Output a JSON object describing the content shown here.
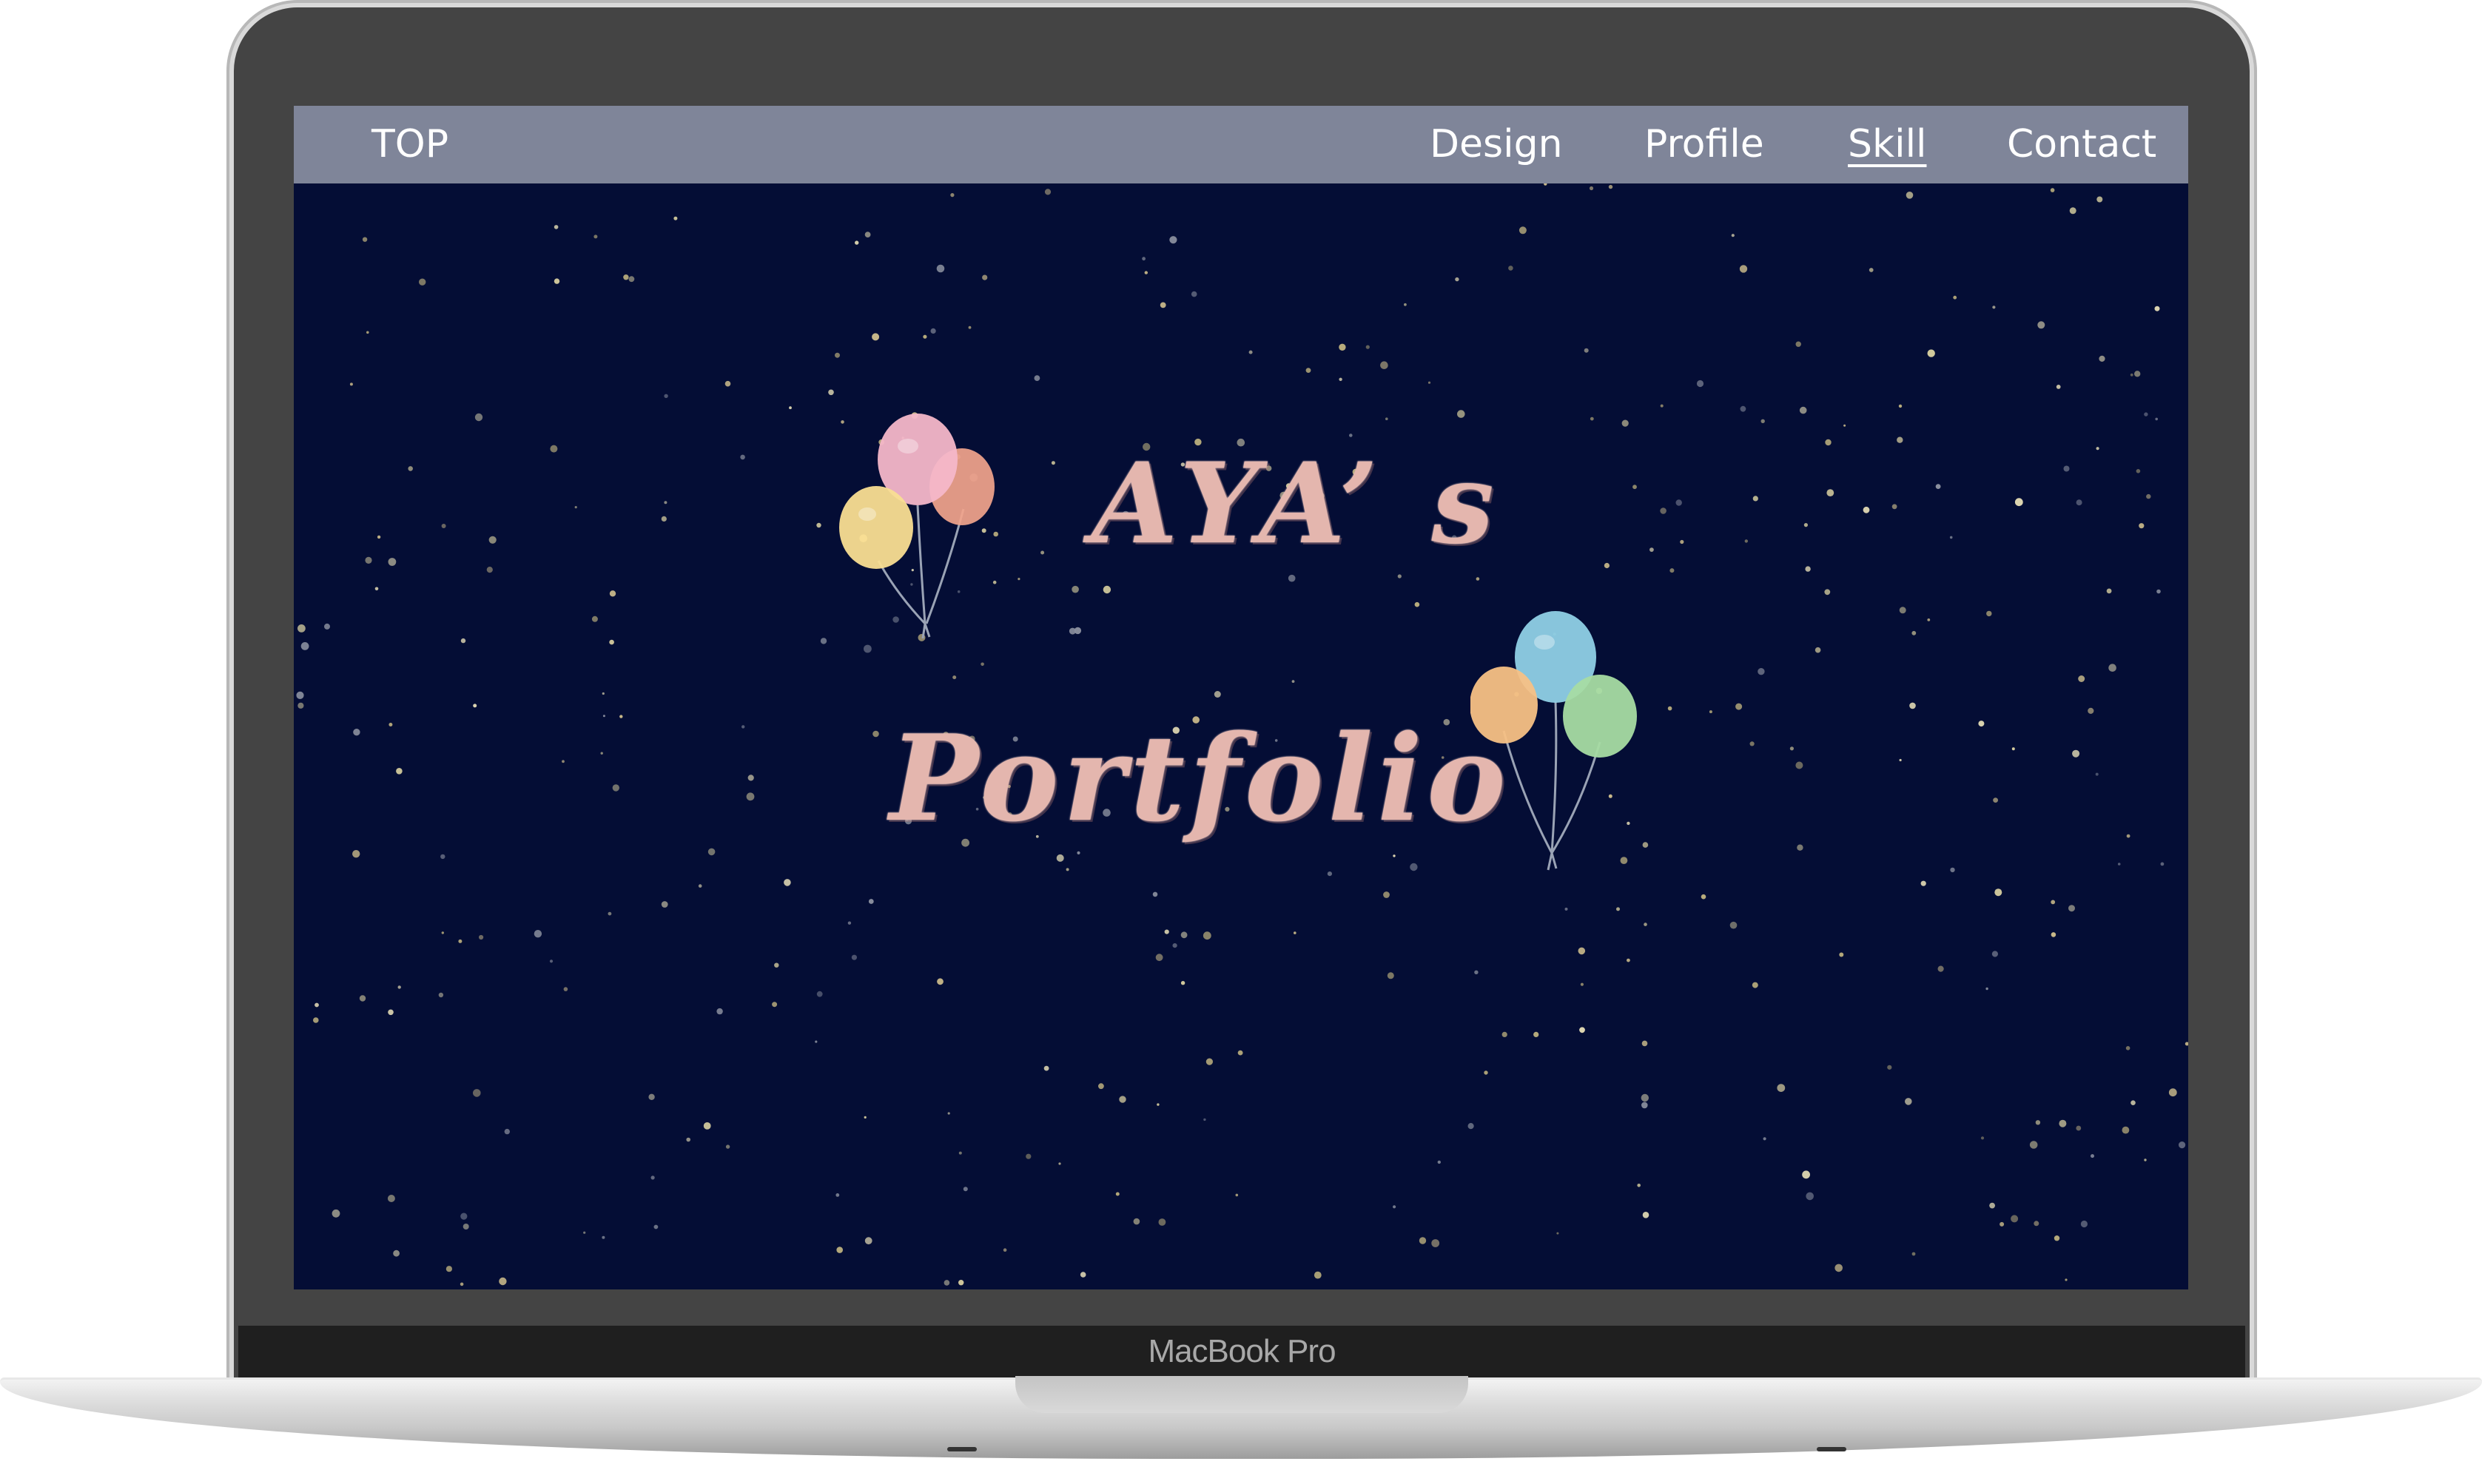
{
  "device": {
    "label": "MacBook Pro"
  },
  "nav": {
    "top_label": "TOP",
    "items": [
      {
        "label": "Design"
      },
      {
        "label": "Profile"
      },
      {
        "label": "Skill",
        "active": true
      },
      {
        "label": "Contact"
      }
    ]
  },
  "hero": {
    "title_line1": "AYA’ s",
    "title_line2": "Portfolio"
  },
  "colors": {
    "background": "#040d35",
    "navbar": "#7f8599",
    "title": "#e4b6ae",
    "bezel": "#444444"
  },
  "icons": [
    "balloons-left-icon",
    "balloons-right-icon"
  ]
}
